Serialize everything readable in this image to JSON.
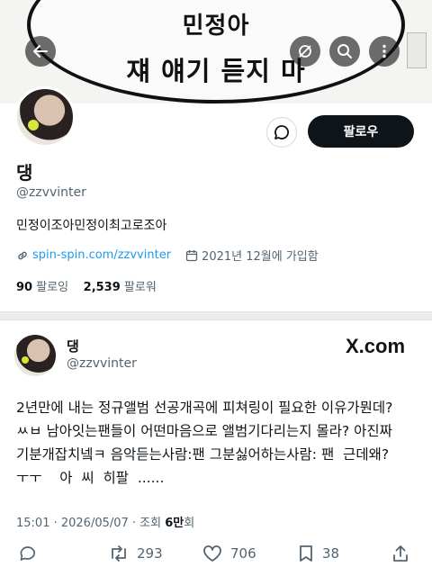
{
  "banner": {
    "line1": "민정아",
    "line2": "쟤 얘기 듣지 마"
  },
  "header_icons": [
    "back-arrow-icon",
    "hide-image-icon",
    "search-icon",
    "more-icon"
  ],
  "profile": {
    "name": "댕",
    "handle": "@zzvvinter",
    "bio": "민정이조아민정이최고로조아",
    "link": "spin-spin.com/zzvvinter",
    "joined": "2021년 12월에 가입함",
    "following_count": "90",
    "following_label": "팔로잉",
    "followers_count": "2,539",
    "followers_label": "팔로워",
    "follow_button": "팔로우"
  },
  "tweet": {
    "name": "댕",
    "handle": "@zzvvinter",
    "source_logo": "X.com",
    "lines": [
      "2년만에 내는 정규앨범 선공개곡에 피쳐링이 필요한 이유가뭔데?",
      "ㅆㅂ 남아잇는팬들이 어떤마음으로 앨범기다리는지 몰라? 아진짜",
      "기분개잡치넼ㅋ 음악듣는사람:팬 그분싫어하는사람: 팬  근데왜?",
      "ㅜㅜ    아  씨  히팔  ......"
    ],
    "timestamp": "15:01 · 2026/05/07 · 조회 ",
    "views": "6만",
    "views_suffix": "회",
    "retweets": "293",
    "likes": "706",
    "bookmarks": "38"
  },
  "colors": {
    "accent": "#1d9bf0",
    "text": "#0f1419",
    "muted": "#536471",
    "follow_bg": "#0f1419"
  }
}
